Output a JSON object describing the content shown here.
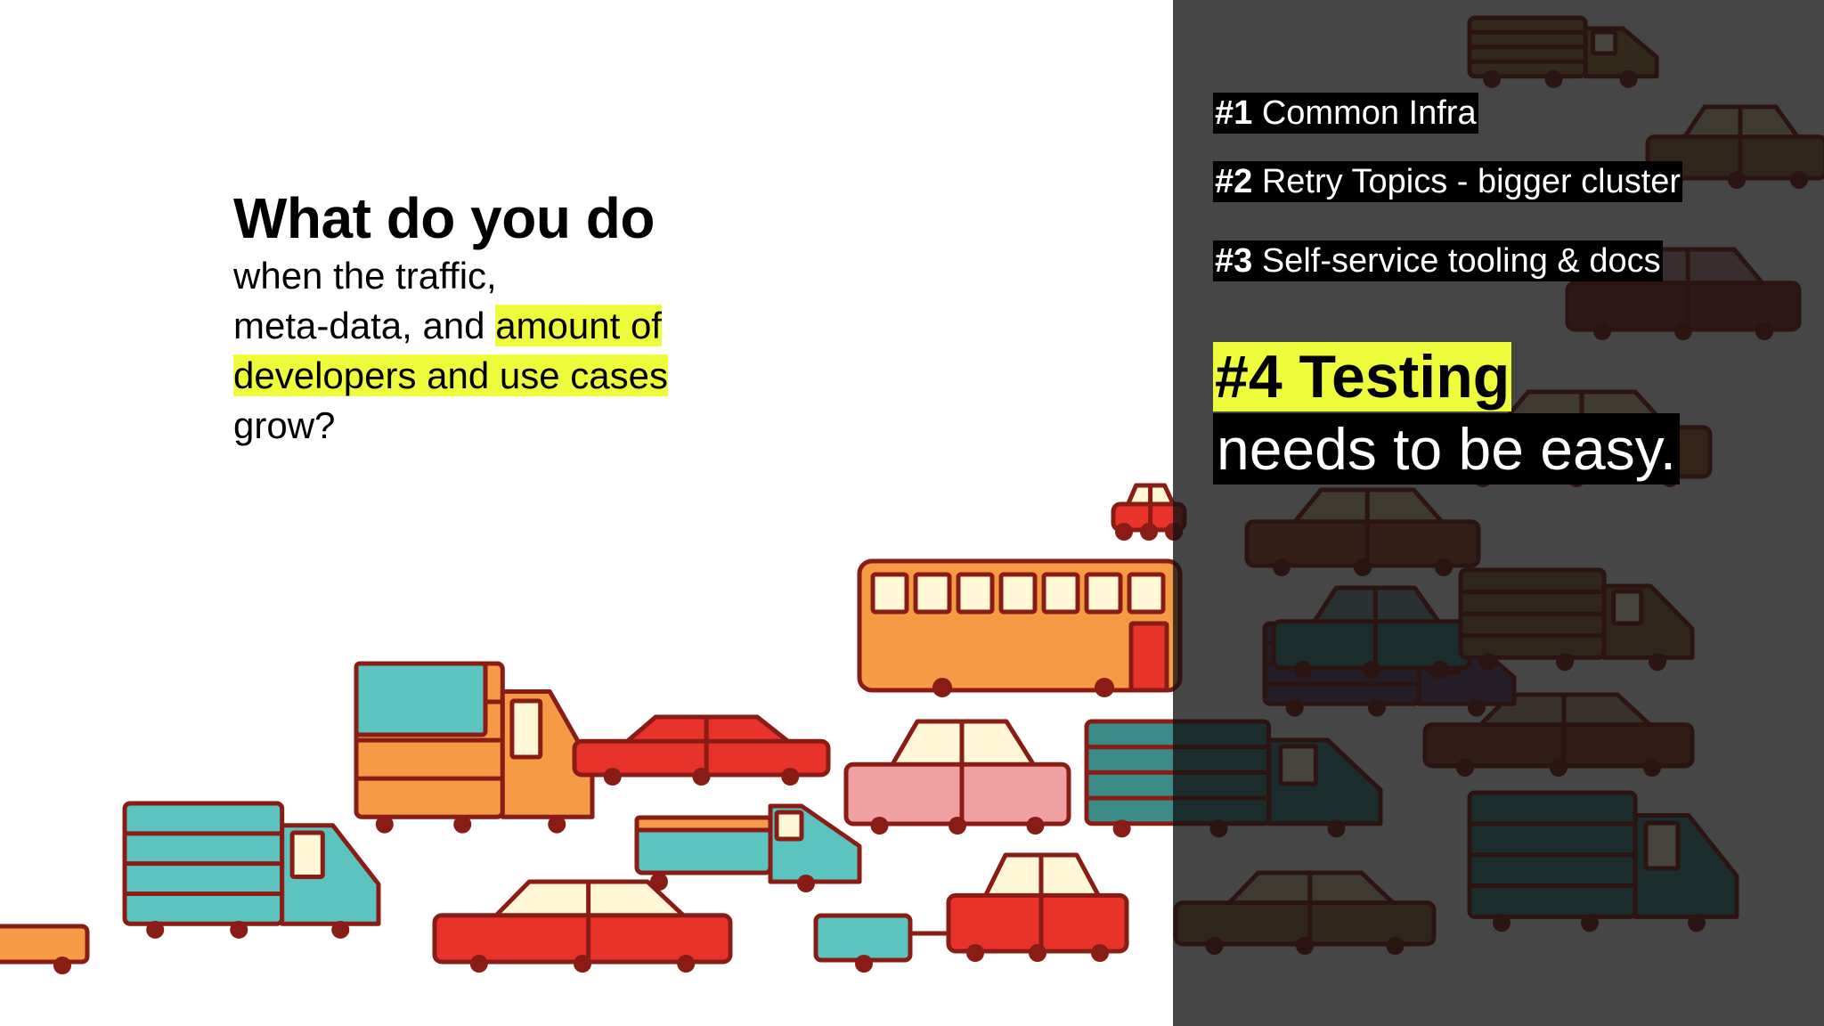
{
  "question": {
    "title": "What do you do",
    "line1": "when the traffic,",
    "line2_plain": "meta-data, and ",
    "line2_highlight": "amount of",
    "line3_highlight": "developers and use cases",
    "line4": "grow?"
  },
  "items": [
    {
      "number": "#1",
      "text": " Common Infra"
    },
    {
      "number": "#2",
      "text": " Retry Topics - bigger cluster"
    },
    {
      "number": "#3",
      "text": " Self-service tooling & docs"
    }
  ],
  "highlight_item": {
    "title": "#4 Testing",
    "subtitle": "needs to be easy."
  },
  "colors": {
    "highlight": "#eefc3c",
    "outline": "#8a1c16",
    "red": "#e8332a",
    "orange": "#f59a45",
    "teal": "#5cc4c0",
    "pink": "#f0a0a0",
    "cream": "#fff7d6",
    "panel_overlay": "rgba(18,18,18,0.78)"
  },
  "illustration": "cartoon-traffic-jam"
}
